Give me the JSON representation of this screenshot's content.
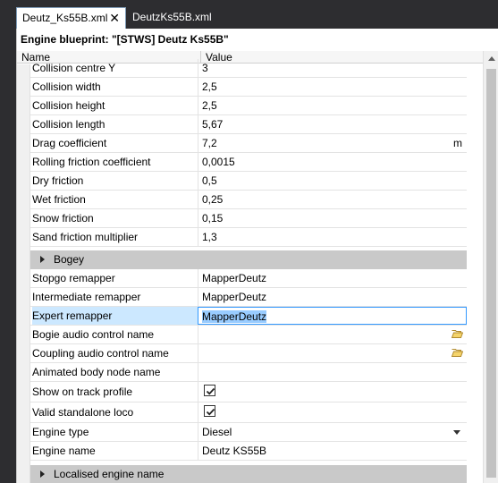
{
  "tabs": [
    {
      "label": "Deutz_Ks55B.xml",
      "close": "✕"
    },
    {
      "label": "DeutzKs55B.xml"
    }
  ],
  "panel": {
    "title": "Engine blueprint: \"[STWS] Deutz Ks55B\""
  },
  "grid": {
    "headers": {
      "name": "Name",
      "value": "Value"
    },
    "rows_top": [
      {
        "name": "Collision centre Y",
        "value": "3"
      },
      {
        "name": "Collision width",
        "value": "2,5"
      },
      {
        "name": "Collision height",
        "value": "2,5"
      },
      {
        "name": "Collision length",
        "value": "5,67"
      },
      {
        "name": "Drag coefficient",
        "value": "7,2",
        "unit": "m"
      },
      {
        "name": "Rolling friction coefficient",
        "value": "0,0015"
      },
      {
        "name": "Dry friction",
        "value": "0,5"
      },
      {
        "name": "Wet friction",
        "value": "0,25"
      },
      {
        "name": "Snow friction",
        "value": "0,15"
      },
      {
        "name": "Sand friction multiplier",
        "value": "1,3"
      }
    ],
    "section_bogey": "Bogey",
    "rows_bottom": [
      {
        "name": "Stopgo remapper",
        "value": "MapperDeutz"
      },
      {
        "name": "Intermediate remapper",
        "value": "MapperDeutz"
      },
      {
        "name": "Expert remapper",
        "value": "MapperDeutz"
      },
      {
        "name": "Bogie audio control name",
        "value": ""
      },
      {
        "name": "Coupling audio control name",
        "value": ""
      },
      {
        "name": "Animated body node name",
        "value": ""
      },
      {
        "name": "Show on track profile",
        "checked": true
      },
      {
        "name": "Valid standalone loco",
        "checked": true
      },
      {
        "name": "Engine type",
        "value": "Diesel"
      },
      {
        "name": "Engine name",
        "value": "Deutz KS55B"
      }
    ],
    "section_localised": "Localised engine name"
  },
  "icons": {
    "browse": "folder-open-icon",
    "check": "checkmark-icon",
    "dropdown": "chevron-down-icon",
    "expand": "triangle-right-icon"
  }
}
